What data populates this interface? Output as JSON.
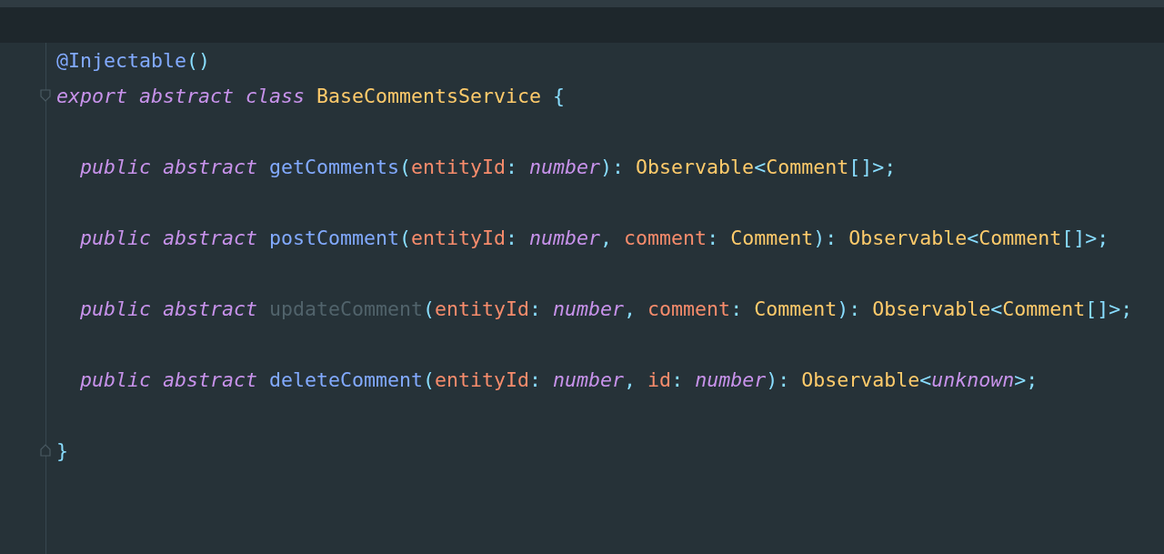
{
  "editor": {
    "lines": [
      {
        "kind": "blank",
        "highlighted": true
      },
      {
        "kind": "code",
        "tokens": [
          {
            "text": "@Injectable",
            "kind": "decorator"
          },
          {
            "text": "()",
            "kind": "punct"
          }
        ]
      },
      {
        "kind": "code",
        "fold_start": true,
        "tokens": [
          {
            "text": "export abstract class",
            "kind": "keyword"
          },
          {
            "text": "BaseCommentsService",
            "kind": "class",
            "space": true
          },
          {
            "text": "{",
            "kind": "punct",
            "space": true
          }
        ]
      },
      {
        "kind": "blank"
      },
      {
        "kind": "code",
        "indented": true,
        "tokens": [
          {
            "text": "public abstract",
            "kind": "keyword"
          },
          {
            "text": "getComments",
            "kind": "method",
            "space": true
          },
          {
            "text": "(",
            "kind": "punct"
          },
          {
            "text": "entityId",
            "kind": "param"
          },
          {
            "text": ":",
            "kind": "punct"
          },
          {
            "text": "number",
            "kind": "type",
            "space": true
          },
          {
            "text": "):",
            "kind": "punct"
          },
          {
            "text": "Observable",
            "kind": "class",
            "space": true
          },
          {
            "text": "<",
            "kind": "punct"
          },
          {
            "text": "Comment",
            "kind": "class"
          },
          {
            "text": "[]>;",
            "kind": "punct"
          }
        ]
      },
      {
        "kind": "blank"
      },
      {
        "kind": "code",
        "indented": true,
        "tokens": [
          {
            "text": "public abstract",
            "kind": "keyword"
          },
          {
            "text": "postComment",
            "kind": "method",
            "space": true
          },
          {
            "text": "(",
            "kind": "punct"
          },
          {
            "text": "entityId",
            "kind": "param"
          },
          {
            "text": ":",
            "kind": "punct"
          },
          {
            "text": "number",
            "kind": "type",
            "space": true
          },
          {
            "text": ",",
            "kind": "punct"
          },
          {
            "text": "comment",
            "kind": "param",
            "space": true
          },
          {
            "text": ":",
            "kind": "punct"
          },
          {
            "text": "Comment",
            "kind": "class",
            "space": true
          },
          {
            "text": "):",
            "kind": "punct"
          },
          {
            "text": "Observable",
            "kind": "class",
            "space": true
          },
          {
            "text": "<",
            "kind": "punct"
          },
          {
            "text": "Comment",
            "kind": "class"
          },
          {
            "text": "[]>;",
            "kind": "punct"
          }
        ]
      },
      {
        "kind": "blank"
      },
      {
        "kind": "code",
        "indented": true,
        "tokens": [
          {
            "text": "public abstract",
            "kind": "keyword"
          },
          {
            "text": "updateComment",
            "kind": "unused",
            "space": true
          },
          {
            "text": "(",
            "kind": "punct"
          },
          {
            "text": "entityId",
            "kind": "param"
          },
          {
            "text": ":",
            "kind": "punct"
          },
          {
            "text": "number",
            "kind": "type",
            "space": true
          },
          {
            "text": ",",
            "kind": "punct"
          },
          {
            "text": "comment",
            "kind": "param",
            "space": true
          },
          {
            "text": ":",
            "kind": "punct"
          },
          {
            "text": "Comment",
            "kind": "class",
            "space": true
          },
          {
            "text": "):",
            "kind": "punct"
          },
          {
            "text": "Observable",
            "kind": "class",
            "space": true
          },
          {
            "text": "<",
            "kind": "punct"
          },
          {
            "text": "Comment",
            "kind": "class"
          },
          {
            "text": "[]>;",
            "kind": "punct"
          }
        ]
      },
      {
        "kind": "blank"
      },
      {
        "kind": "code",
        "indented": true,
        "tokens": [
          {
            "text": "public abstract",
            "kind": "keyword"
          },
          {
            "text": "deleteComment",
            "kind": "method",
            "space": true
          },
          {
            "text": "(",
            "kind": "punct"
          },
          {
            "text": "entityId",
            "kind": "param"
          },
          {
            "text": ":",
            "kind": "punct"
          },
          {
            "text": "number",
            "kind": "type",
            "space": true
          },
          {
            "text": ",",
            "kind": "punct"
          },
          {
            "text": "id",
            "kind": "param",
            "space": true
          },
          {
            "text": ":",
            "kind": "punct"
          },
          {
            "text": "number",
            "kind": "type",
            "space": true
          },
          {
            "text": "):",
            "kind": "punct"
          },
          {
            "text": "Observable",
            "kind": "class",
            "space": true
          },
          {
            "text": "<",
            "kind": "punct"
          },
          {
            "text": "unknown",
            "kind": "type"
          },
          {
            "text": ">;",
            "kind": "punct"
          }
        ]
      },
      {
        "kind": "blank"
      },
      {
        "kind": "code",
        "fold_end": true,
        "tokens": [
          {
            "text": "}",
            "kind": "punct"
          }
        ]
      }
    ]
  }
}
